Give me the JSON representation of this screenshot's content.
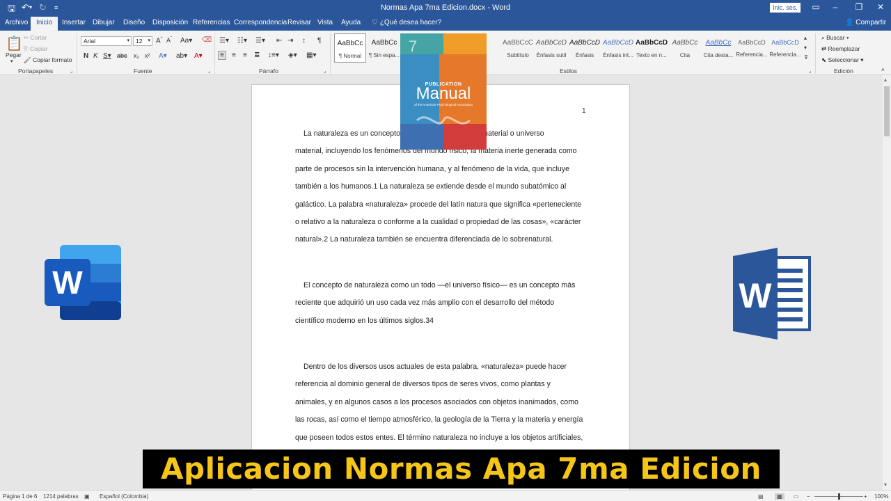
{
  "titlebar": {
    "title": "Normas Apa 7ma Edicion.docx  -  Word",
    "signin": "Inic. ses.",
    "save_icon": "save-icon",
    "undo_icon": "undo-icon",
    "redo_icon": "redo-icon"
  },
  "tabs": [
    "Archivo",
    "Inicio",
    "Insertar",
    "Dibujar",
    "Diseño",
    "Disposición",
    "Referencias",
    "Correspondencia",
    "Revisar",
    "Vista",
    "Ayuda"
  ],
  "tellme": "¿Qué desea hacer?",
  "share": "Compartir",
  "ribbon": {
    "clipboard": {
      "label": "Portapapeles",
      "paste": "Pegar",
      "cut": "Cortar",
      "copy": "Copiar",
      "format_painter": "Copiar formato"
    },
    "font": {
      "label": "Fuente",
      "family": "Arial",
      "size": "12"
    },
    "paragraph": {
      "label": "Párrafo"
    },
    "styles": {
      "label": "Estilos",
      "items": [
        {
          "preview": "AaBbCc",
          "name": "¶ Normal"
        },
        {
          "preview": "AaBbCc",
          "name": "¶ Sin espa..."
        },
        {
          "preview": "AaBbCcC",
          "name": "Subtítulo"
        },
        {
          "preview": "AaBbCcD",
          "name": "Énfasis sutil"
        },
        {
          "preview": "AaBbCcD",
          "name": "Énfasis"
        },
        {
          "preview": "AaBbCcD",
          "name": "Énfasis int..."
        },
        {
          "preview": "AaBbCcD",
          "name": "Texto en n..."
        },
        {
          "preview": "AaBbCc",
          "name": "Cita"
        },
        {
          "preview": "AaBbCc",
          "name": "Cita desta..."
        },
        {
          "preview": "AaBbCcD",
          "name": "Referencia..."
        },
        {
          "preview": "AaBbCcD",
          "name": "Referencia..."
        }
      ]
    },
    "editing": {
      "label": "Edición",
      "find": "Buscar",
      "replace": "Reemplazar",
      "select": "Seleccionar"
    }
  },
  "document": {
    "page_number": "1",
    "paragraphs": [
      [
        "La naturaleza es un concepto que se refiere al mundo material o universo",
        "material, incluyendo los fenómenos del mundo físico, la materia inerte generada como",
        "parte de procesos sin la intervención humana, y al fenómeno de la vida, que incluye",
        "también a los humanos.1 La naturaleza se extiende desde el mundo subatómico al",
        "galáctico. La palabra «naturaleza» procede del latín natura que significa «perteneciente",
        "o relativo a la naturaleza o conforme a la cualidad o propiedad de las cosas», «carácter",
        "natural».2 La naturaleza también se encuentra diferenciada de lo sobrenatural."
      ],
      [
        "El concepto de naturaleza como un todo —el universo físico— es un concepto más",
        "reciente que adquirió un uso cada vez más amplio con el desarrollo del método",
        "científico moderno en los últimos siglos.34"
      ],
      [
        "Dentro de los diversos usos actuales de esta palabra, «naturaleza» puede hacer",
        "referencia al dominio general de diversos tipos de seres vivos, como plantas y",
        "animales, y en algunos casos a los procesos asociados con objetos inanimados, como",
        "las rocas, así como el tiempo atmosférico, la geología de la Tierra y la materia y energía",
        "que poseen todos estos entes. El término naturaleza no incluye a los objetos artificiales,"
      ]
    ]
  },
  "status": {
    "page": "Página 1 de 6",
    "words": "1214 palabras",
    "language": "Español (Colombia)",
    "zoom": "100%"
  },
  "overlay": {
    "banner": "Aplicacion Normas Apa 7ma Edicion",
    "book": {
      "top_line": "PUBLICATION",
      "title": "Manual",
      "subtitle": "of the American Psychological Association",
      "edition": "7"
    },
    "logo_letter": "W"
  },
  "colors": {
    "word_blue": "#2b579a",
    "banner_yellow": "#f5c518"
  }
}
